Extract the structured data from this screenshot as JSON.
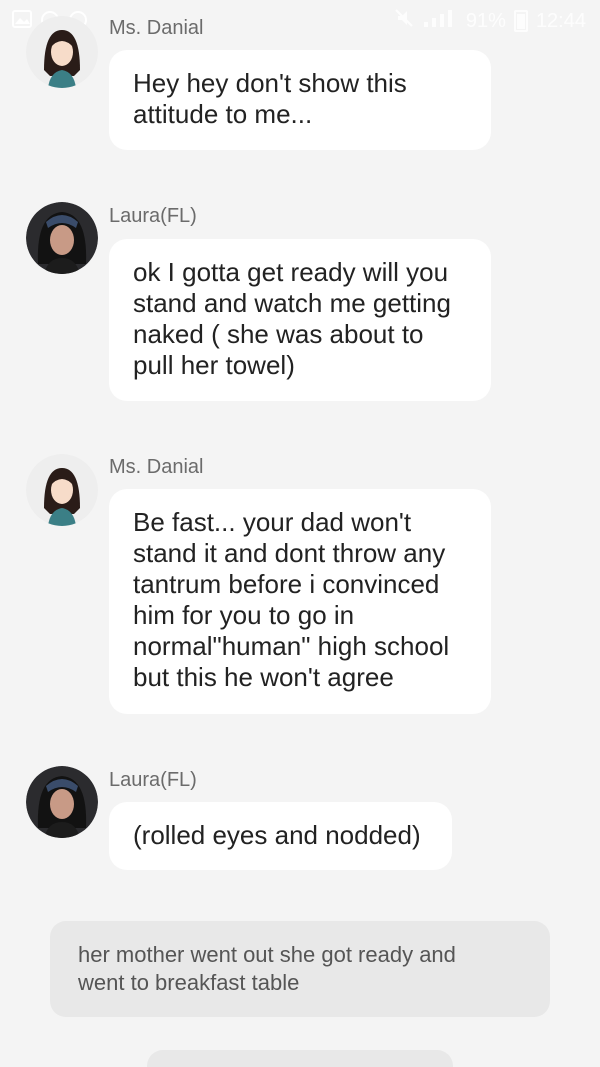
{
  "status_bar": {
    "battery": "91%",
    "time": "12:44",
    "icons": [
      "image-icon",
      "notification-icon",
      "notification-icon",
      "mute-icon",
      "signal-icon",
      "battery-icon"
    ]
  },
  "messages": [
    {
      "sender": "Ms. Danial",
      "avatar": "ms-danial-avatar",
      "text": "Hey hey don't show this\nattitude to me..."
    },
    {
      "sender": "Laura(FL)",
      "avatar": "laura-avatar",
      "text": "ok I gotta get ready will you\nstand and watch me getting\nnaked ( she was about to\npull her towel)"
    },
    {
      "sender": "Ms. Danial",
      "avatar": "ms-danial-avatar",
      "text": "Be fast... your dad won't\nstand it and dont throw any\ntantrum before i convinced\nhim for you to go in\nnormal\"human\" high school\nbut this he won't agree"
    },
    {
      "sender": "Laura(FL)",
      "avatar": "laura-avatar",
      "text": "(rolled eyes and nodded)"
    }
  ],
  "narration": "her mother went out she got ready and\nwent to breakfast table"
}
